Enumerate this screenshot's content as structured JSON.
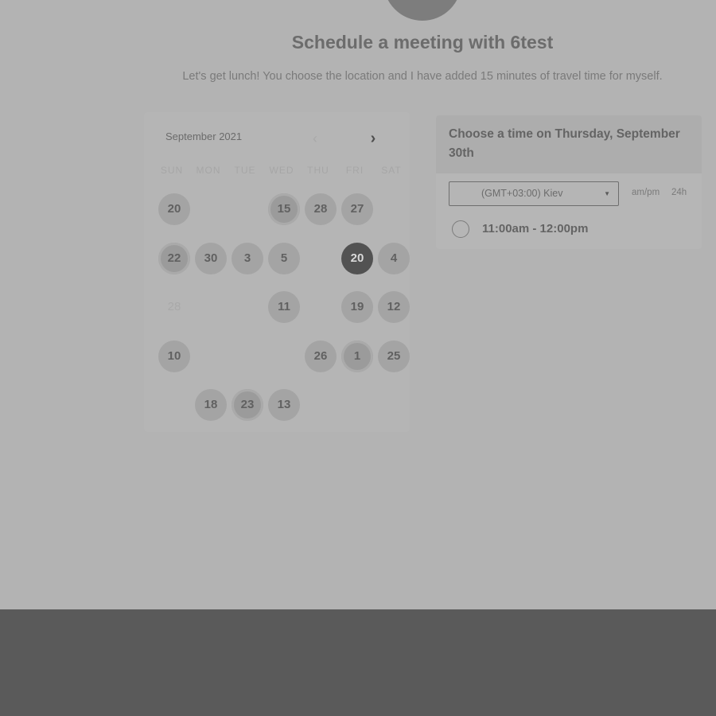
{
  "header": {
    "title": "Schedule a meeting with 6test",
    "subtitle": "Let's get lunch! You choose the location and I have added 15 minutes of travel time for myself."
  },
  "calendar": {
    "month": "September 2021",
    "prev_icon": "‹",
    "next_icon": "›",
    "weekdays": [
      "SUN",
      "MON",
      "TUE",
      "WED",
      "THU",
      "FRI",
      "SAT"
    ],
    "weeks": [
      [
        {
          "label": "20",
          "state": "available"
        },
        null,
        null,
        {
          "label": "15",
          "state": "dotted"
        },
        {
          "label": "28",
          "state": "available"
        },
        {
          "label": "27",
          "state": "available"
        },
        null
      ],
      [
        {
          "label": "22",
          "state": "dotted"
        },
        {
          "label": "30",
          "state": "available"
        },
        {
          "label": "3",
          "state": "available"
        },
        {
          "label": "5",
          "state": "available"
        },
        null,
        {
          "label": "20",
          "state": "selected"
        },
        {
          "label": "4",
          "state": "available"
        }
      ],
      [
        {
          "label": "28",
          "state": "disabled"
        },
        null,
        null,
        {
          "label": "11",
          "state": "available"
        },
        null,
        {
          "label": "19",
          "state": "available"
        },
        {
          "label": "12",
          "state": "available"
        }
      ],
      [
        {
          "label": "10",
          "state": "available"
        },
        null,
        null,
        null,
        {
          "label": "26",
          "state": "available"
        },
        {
          "label": "1",
          "state": "dotted"
        },
        {
          "label": "25",
          "state": "available"
        }
      ],
      [
        null,
        {
          "label": "18",
          "state": "available"
        },
        {
          "label": "23",
          "state": "dotted"
        },
        {
          "label": "13",
          "state": "available"
        },
        null,
        null,
        null
      ]
    ]
  },
  "time_panel": {
    "heading": "Choose a time on Thursday, September 30th",
    "timezone": "(GMT+03:00) Kiev",
    "caret": "▼",
    "format_ampm": "am/pm",
    "format_24h": "24h",
    "slots": [
      "11:00am - 12:00pm"
    ]
  }
}
